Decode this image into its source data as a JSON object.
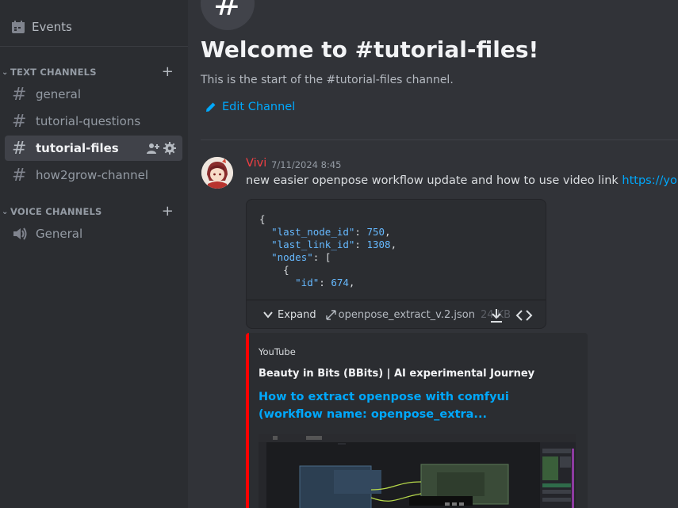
{
  "sidebar": {
    "events_label": "Events",
    "categories": {
      "text": "TEXT CHANNELS",
      "voice": "VOICE CHANNELS"
    },
    "text_channels": [
      "general",
      "tutorial-questions",
      "tutorial-files",
      "how2grow-channel"
    ],
    "active_channel": "tutorial-files",
    "voice_channels": [
      "General"
    ]
  },
  "main": {
    "welcome_title": "Welcome to #tutorial-files!",
    "start_text": "This is the start of the #tutorial-files channel.",
    "edit_channel": "Edit Channel"
  },
  "message": {
    "author": "Vivi",
    "author_color": "#f23f43",
    "timestamp": "7/11/2024 8:45",
    "text": "new easier openpose workflow update and how to use video link ",
    "link": "https://youtu.be",
    "file": {
      "code_lines": [
        {
          "indent": "",
          "text": "{"
        },
        {
          "indent": "  ",
          "key": "\"last_node_id\"",
          "sep": ": ",
          "value": "750",
          "end": ","
        },
        {
          "indent": "  ",
          "key": "\"last_link_id\"",
          "sep": ": ",
          "value": "1308",
          "end": ","
        },
        {
          "indent": "  ",
          "key": "\"nodes\"",
          "sep": ": ",
          "value": "",
          "end": "["
        },
        {
          "indent": "    ",
          "text": "{"
        },
        {
          "indent": "      ",
          "key": "\"id\"",
          "sep": ": ",
          "value": "674",
          "end": ","
        }
      ],
      "expand_label": "Expand",
      "filename": "openpose_extract_v.2.json",
      "size": "24 KB"
    },
    "embed": {
      "provider": "YouTube",
      "author": "Beauty in Bits (BBits) | AI experimental Journey",
      "title": "How to extract openpose with comfyui (workflow name: openpose_extra...",
      "accent": "#ff0000"
    }
  }
}
